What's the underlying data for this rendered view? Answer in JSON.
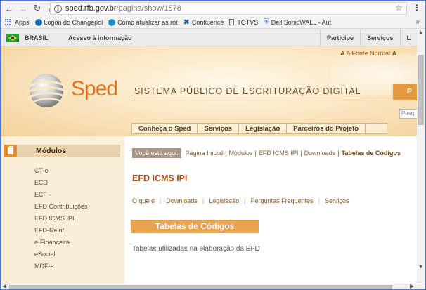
{
  "browser": {
    "url_domain": "sped.rfb.gov.br",
    "url_path": "/pagina/show/1578",
    "bookmarks": [
      {
        "label": "Apps",
        "icon": "apps-grid-icon"
      },
      {
        "label": "Logon do Changepoi",
        "icon": "changepoint-icon",
        "color": "#1c6fb8"
      },
      {
        "label": "Como atualizar as rot",
        "icon": "circle-icon",
        "color": "#1f8fcf"
      },
      {
        "label": "Confluence",
        "icon": "confluence-icon",
        "color": "#2058a8"
      },
      {
        "label": "TOTVS",
        "icon": "page-icon"
      },
      {
        "label": "Dell SonicWALL - Aut",
        "icon": "shield-icon",
        "color": "#3168c6"
      }
    ],
    "overflow_label": "»"
  },
  "govbar": {
    "brasil": "BRASIL",
    "acesso": "Acesso à informação",
    "right_links": [
      "Participe",
      "Serviços",
      "L"
    ]
  },
  "header": {
    "fonte": "A Fonte Normal",
    "fonte_extra": "A",
    "logo_text": "Sped",
    "tagline": "SISTEMA PÚBLICO DE ESCRITURAÇÃO DIGITAL",
    "tab_text": "P",
    "search_placeholder": "Pesq",
    "nav": [
      "Conheça o Sped",
      "Serviços",
      "Legislação",
      "Parceiros do Projeto"
    ]
  },
  "sidebar": {
    "title": "Módulos",
    "items": [
      "CT-e",
      "ECD",
      "ECF",
      "EFD Contribuições",
      "EFD ICMS IPI",
      "EFD-Reinf",
      "e-Financeira",
      "eSocial",
      "MDF-e"
    ]
  },
  "content": {
    "crumb_label": "Você está aqui:",
    "crumbs": [
      "Página Inicial",
      "Módulos",
      "EFD ICMS IPI",
      "Downloads"
    ],
    "crumb_current": "Tabelas de Códigos",
    "title": "EFD ICMS IPI",
    "subtabs": [
      "O que é",
      "Downloads",
      "Legislação",
      "Perguntas Frequentes",
      "Serviços"
    ],
    "section_button": "Tabelas de Códigos",
    "description": "Tabelas utilizadas na elaboração da EFD"
  },
  "colors": {
    "accent_orange": "#e69a3e",
    "title_orange": "#a84c16",
    "sidebar_bg": "#fbeed8"
  }
}
